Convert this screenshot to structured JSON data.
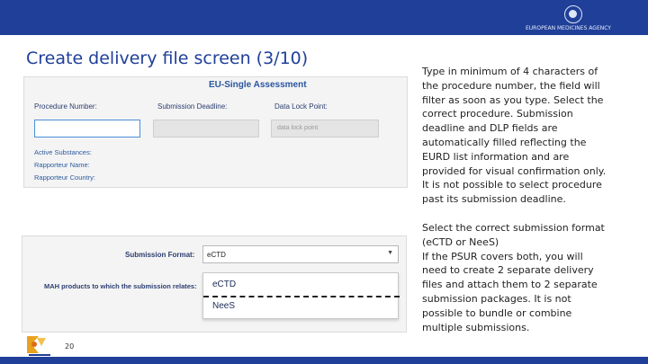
{
  "header": {
    "agency_name": "EUROPEAN MEDICINES AGENCY",
    "colors": {
      "bar": "#1f3f99",
      "title": "#1f3f99"
    }
  },
  "slide": {
    "title": "Create delivery file screen (3/10)",
    "page_number": "20"
  },
  "screenshot1": {
    "heading": "EU-Single Assessment",
    "fields": {
      "procedure_number_label": "Procedure Number:",
      "submission_deadline_label": "Submission Deadline:",
      "data_lock_point_label": "Data Lock Point:",
      "data_lock_point_placeholder": "data lock point"
    },
    "info_labels": [
      "Active Substances:",
      "Rapporteur Name:",
      "Rapporteur Country:"
    ]
  },
  "screenshot2": {
    "submission_format_label": "Submission Format:",
    "mah_products_label": "MAH products to which the submission relates:",
    "selected_value": "eCTD",
    "options": [
      "eCTD",
      "NeeS"
    ]
  },
  "text": {
    "paragraph1_lines": [
      "Type in minimum of 4 characters of",
      "the procedure number, the field will",
      "filter as soon as you type. Select the",
      "correct procedure. Submission",
      "deadline and DLP fields are",
      "automatically filled reflecting the",
      "EURD list information and are",
      "provided for visual confirmation only.",
      "It is not possible to select procedure",
      "past its submission deadline."
    ],
    "paragraph2_lines": [
      "Select the correct submission format",
      "(eCTD or NeeS)",
      "If the PSUR covers both, you will",
      "need to create 2 separate delivery",
      "files and attach them to 2 separate",
      "submission packages. It is not",
      "possible to bundle or combine",
      "multiple submissions."
    ]
  }
}
